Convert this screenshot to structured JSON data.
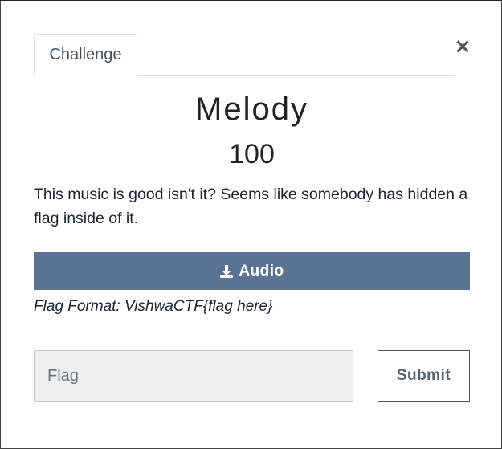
{
  "modal": {
    "tab_label": "Challenge",
    "close_glyph": "×"
  },
  "challenge": {
    "name": "Melody",
    "points": "100",
    "description": "This music is good isn't it? Seems like somebody has hidden a flag inside of it.",
    "download": {
      "icon": "download-icon",
      "label": "Audio"
    },
    "flag_format": "Flag Format: VishwaCTF{flag here}"
  },
  "form": {
    "flag_placeholder": "Flag",
    "flag_value": "",
    "submit_label": "Submit"
  },
  "colors": {
    "download_button": "#5b7290",
    "submit_border": "#5a5a5a",
    "input_background": "#efefef"
  }
}
